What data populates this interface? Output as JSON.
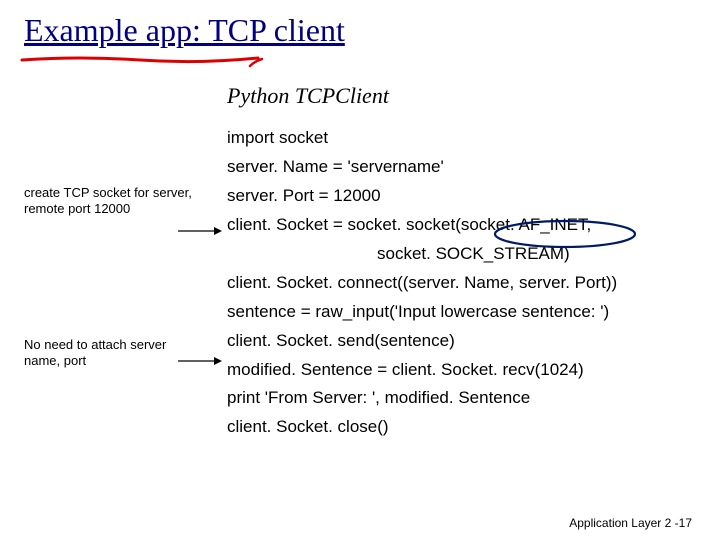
{
  "title": "Example  app: TCP client",
  "subtitle": "Python TCPClient",
  "code": {
    "l1": "import socket",
    "l2": "server. Name = 'servername'",
    "l3": "server. Port = 12000",
    "l4": "client. Socket = socket. socket(socket. AF_INET,",
    "l5": "socket. SOCK_STREAM)",
    "l6": "client. Socket. connect((server. Name, server. Port))",
    "l7": "sentence = raw_input('Input lowercase sentence: ')",
    "l8": "client. Socket. send(sentence)",
    "l9": "modified. Sentence = client. Socket. recv(1024)",
    "l10": "print 'From Server: ', modified. Sentence",
    "l11": "client. Socket. close()"
  },
  "annotations": {
    "a1": "create TCP socket for server, remote port 12000",
    "a2": "No need to attach server name, port"
  },
  "footer": "Application Layer 2 -17"
}
